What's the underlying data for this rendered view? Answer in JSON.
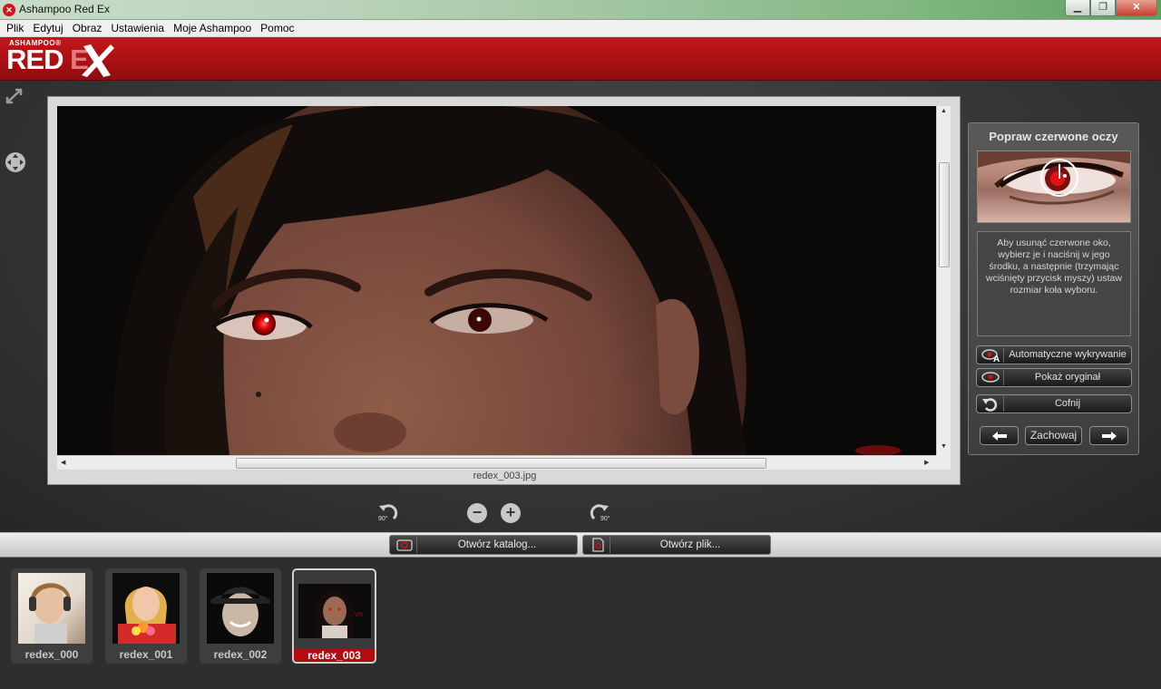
{
  "window": {
    "title": "Ashampoo Red Ex",
    "buttons": {
      "minimize": "▁",
      "maximize": "❐",
      "close": "✕"
    }
  },
  "menu": [
    "Plik",
    "Edytuj",
    "Obraz",
    "Ustawienia",
    "Moje Ashampoo",
    "Pomoc"
  ],
  "logo": {
    "brand": "ASHAMPOO®",
    "product_red": "RED",
    "product_e": "E"
  },
  "image": {
    "filename": "redex_003.jpg"
  },
  "right_panel": {
    "title": "Popraw czerwone oczy",
    "help_text": "Aby usunąć czerwone oko, wybierz je i naciśnij w jego środku, a następnie (trzymając wciśnięty przycisk myszy) ustaw rozmiar koła wyboru.",
    "buttons": {
      "auto_detect": "Automatyczne wykrywanie",
      "show_original": "Pokaż oryginał",
      "undo": "Cofnij",
      "save": "Zachowaj"
    }
  },
  "toolbar": {
    "rotate_left_deg": "90°",
    "rotate_right_deg": "90°"
  },
  "open_buttons": {
    "open_catalog": "Otwórz katalog...",
    "open_file": "Otwórz plik..."
  },
  "thumbnails": [
    {
      "label": "redex_000",
      "selected": false
    },
    {
      "label": "redex_001",
      "selected": false
    },
    {
      "label": "redex_002",
      "selected": false
    },
    {
      "label": "redex_003",
      "selected": true
    }
  ],
  "colors": {
    "brand_red": "#b30c10",
    "header_red": "#c3171b"
  }
}
